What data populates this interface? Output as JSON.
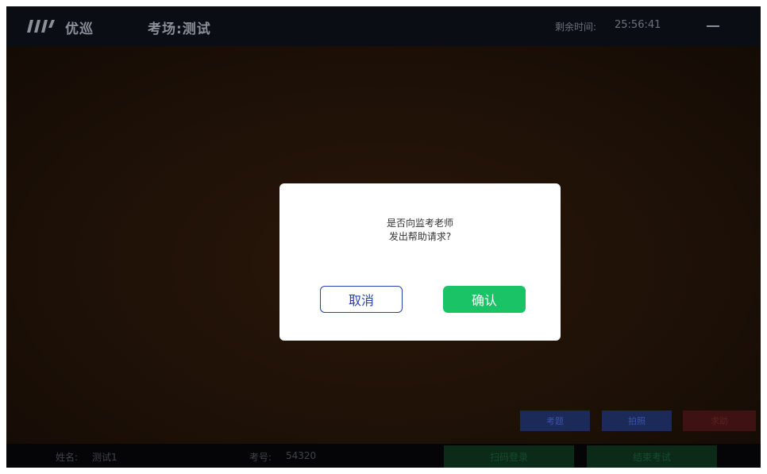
{
  "header": {
    "brand": "优巡",
    "exam_title": "考场:测试",
    "timer_label": "剩余时间:",
    "timer_value": "25:56:41"
  },
  "actions": {
    "questions": "考题",
    "photo": "拍照",
    "help": "求助"
  },
  "modal": {
    "line1": "是否向监考老师",
    "line2": "发出帮助请求?",
    "cancel": "取消",
    "confirm": "确认"
  },
  "footer": {
    "name_label": "姓名:",
    "name_value": "测试1",
    "id_label": "考号:",
    "id_value": "54320",
    "scan_login": "扫码登录",
    "end_exam": "结束考试"
  },
  "colors": {
    "confirm": "#1ac466",
    "cancel_border": "#2741b5",
    "modal_bg": "#ffffff"
  }
}
